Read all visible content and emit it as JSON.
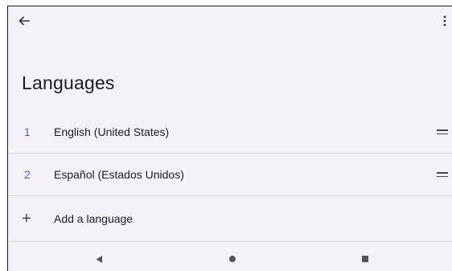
{
  "header": {
    "title": "Languages"
  },
  "languages": [
    {
      "index": "1",
      "label": "English (United States)"
    },
    {
      "index": "2",
      "label": "Español (Estados Unidos)"
    }
  ],
  "add_language": {
    "icon": "+",
    "label": "Add a language"
  },
  "icons": {
    "back": "back-arrow-icon",
    "more": "more-vert-icon",
    "drag": "drag-handle-icon",
    "nav_back": "nav-back-triangle-icon",
    "nav_home": "nav-home-circle-icon",
    "nav_recents": "nav-recents-square-icon"
  },
  "colors": {
    "background": "#f5f1f9",
    "accent_number": "#4a5fc1",
    "divider": "#d8d4dc",
    "text": "#1c1b1f"
  }
}
